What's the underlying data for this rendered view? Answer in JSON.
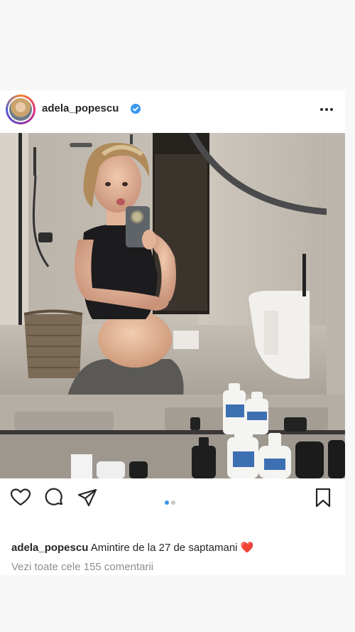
{
  "post": {
    "username": "adela_popescu",
    "caption_text": "Amintire de la 27 de saptamani",
    "caption_emoji": "❤️",
    "view_comments": "Vezi toate cele 155 comentarii",
    "carousel": {
      "count": 2,
      "active": 0
    }
  },
  "icons": {
    "verified": "verified-badge-icon",
    "more": "more-options-icon",
    "like": "heart-icon",
    "comment": "comment-bubble-icon",
    "share": "paper-plane-icon",
    "save": "bookmark-icon"
  },
  "colors": {
    "text": "#262626",
    "muted": "#8e8e8e",
    "verified": "#3897f0",
    "dot_active": "#3897f0",
    "dot_inactive": "#c7c7c7"
  }
}
